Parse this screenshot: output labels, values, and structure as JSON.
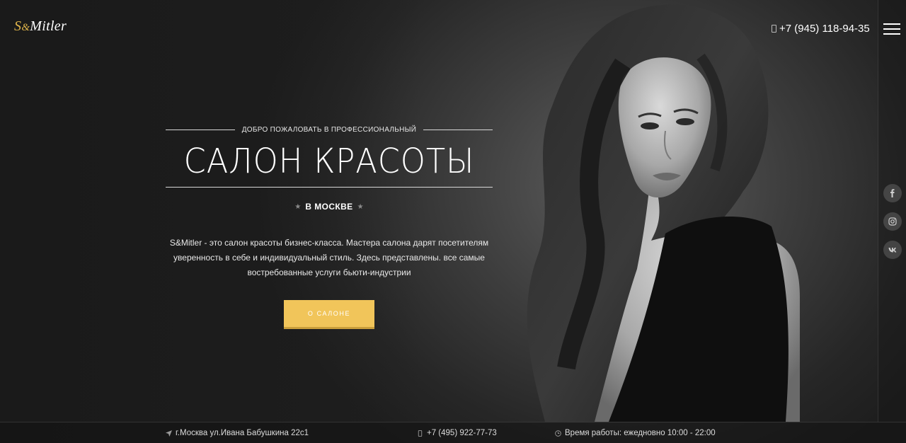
{
  "brand": {
    "logo_prefix": "S",
    "logo_amp": "&",
    "logo_rest": "Mitler"
  },
  "header": {
    "phone": "+7 (945) 118-94-35",
    "menu_icon": "hamburger-icon"
  },
  "hero": {
    "kicker": "ДОБРО ПОЖАЛОВАТЬ В ПРОФЕССИОНАЛЬНЫЙ",
    "title": "САЛОН КРАСОТЫ",
    "city": "В МОСКВЕ",
    "description": "S&Mitler - это салон красоты бизнес-класса. Мастера салона дарят посетителям уверенность в себе и индивидуальный стиль. Здесь представлены. все самые востребованные услуги бьюти-индустрии",
    "button_label": "О САЛОНЕ"
  },
  "social": [
    {
      "name": "facebook-icon"
    },
    {
      "name": "instagram-icon"
    },
    {
      "name": "vk-icon"
    }
  ],
  "footer": {
    "address": "г.Москва ул.Ивана Бабушкина 22с1",
    "phone": "+7 (495) 922-77-73",
    "hours": "Время работы: ежедновно 10:00 - 22:00"
  },
  "colors": {
    "accent": "#f1c55a",
    "background": "#1c1c1c"
  }
}
